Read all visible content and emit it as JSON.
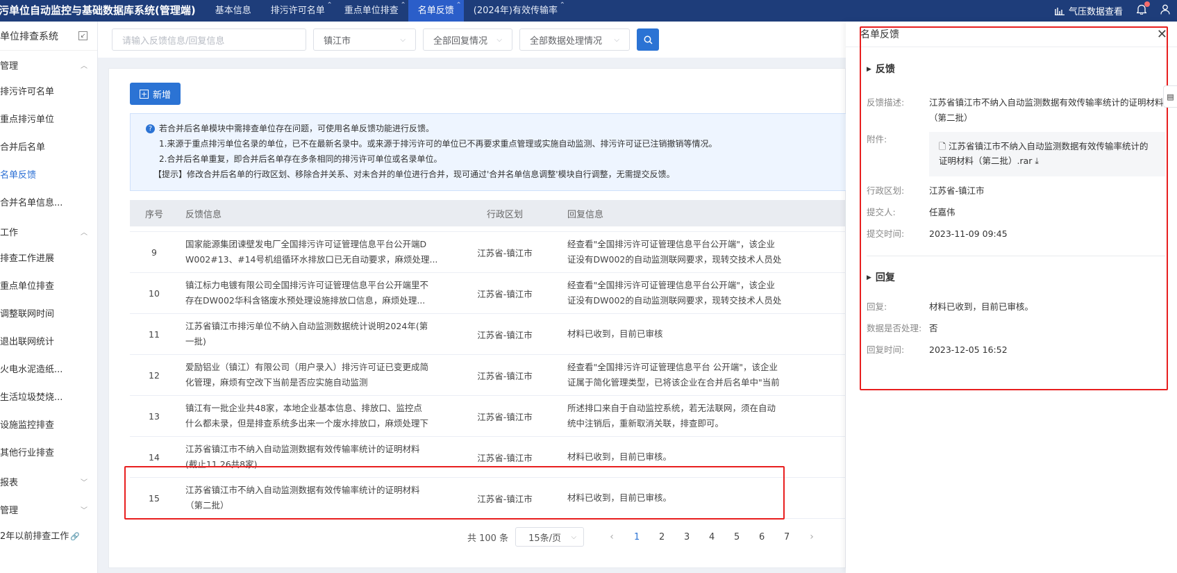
{
  "topbar": {
    "title": "污单位自动监控与基础数据库系统(管理端)",
    "tabs": [
      {
        "label": "基本信息",
        "closable": false,
        "active": false
      },
      {
        "label": "排污许可名单",
        "closable": true,
        "active": false
      },
      {
        "label": "重点单位排查",
        "closable": true,
        "active": false
      },
      {
        "label": "名单反馈",
        "closable": true,
        "active": true
      },
      {
        "label": "(2024年)有效传输率",
        "closable": true,
        "active": false
      }
    ],
    "pressure_label": "气压数据查看"
  },
  "sidebar": {
    "header": "单位排查系统",
    "items": [
      {
        "type": "group",
        "label": "管理",
        "expanded": true
      },
      {
        "type": "item",
        "label": "排污许可名单"
      },
      {
        "type": "item",
        "label": "重点排污单位"
      },
      {
        "type": "item",
        "label": "合并后名单"
      },
      {
        "type": "item",
        "label": "名单反馈",
        "active": true
      },
      {
        "type": "item",
        "label": "合并名单信息..."
      },
      {
        "type": "group",
        "label": "工作",
        "expanded": true
      },
      {
        "type": "item",
        "label": "排查工作进展"
      },
      {
        "type": "item",
        "label": "重点单位排查"
      },
      {
        "type": "item",
        "label": "调整联网时间"
      },
      {
        "type": "item",
        "label": "退出联网统计"
      },
      {
        "type": "item",
        "label": "火电水泥造纸..."
      },
      {
        "type": "item",
        "label": "生活垃圾焚烧..."
      },
      {
        "type": "item",
        "label": "设施监控排查"
      },
      {
        "type": "item",
        "label": "其他行业排查"
      },
      {
        "type": "group",
        "label": "报表",
        "expanded": false
      },
      {
        "type": "group",
        "label": "管理",
        "expanded": false
      },
      {
        "type": "item",
        "label": "2年以前排查工作",
        "external": true
      }
    ]
  },
  "filters": {
    "search_placeholder": "请输入反馈信息/回复信息",
    "city": "镇江市",
    "reply_status": "全部回复情况",
    "data_status": "全部数据处理情况"
  },
  "main": {
    "add_label": "新增",
    "notice": [
      "若合并后名单模块中需排查单位存在问题，可使用名单反馈功能进行反馈。",
      "1.来源于重点排污单位名录的单位，已不在最新名录中。或来源于排污许可的单位已不再要求重点管理或实施自动监测、排污许可证已注销撤销等情况。",
      "2.合并后名单重复，即合并后名单存在多条相同的排污许可单位或名录单位。",
      "【提示】修改合并后名单的行政区划、移除合并关系、对未合并的单位进行合并，现可通过'合并名单信息调整'模块自行调整，无需提交反馈。"
    ],
    "columns": {
      "no": "序号",
      "feedback": "反馈信息",
      "area": "行政区划",
      "reply": "回复信息"
    },
    "rows": [
      {
        "no": "9",
        "fb1": "国家能源集团谏壁发电厂全国排污许可证管理信息平台公开端D",
        "fb2": "W002#13、#14号机组循环水排放口已无自动要求，麻烦处理...",
        "area": "江苏省-镇江市",
        "r1": "经查看\"全国排污许可证管理信息平台公开端\"，该企业",
        "r2": "证没有DW002的自动监测联网要求，现转交技术人员处"
      },
      {
        "no": "10",
        "fb1": "镇江标力电镀有限公司全国排污许可证管理信息平台公开端里不",
        "fb2": "存在DW002华科含铬废水预处理设施排放口信息，麻烦处理...",
        "area": "江苏省-镇江市",
        "r1": "经查看\"全国排污许可证管理信息平台公开端\"，该企业",
        "r2": "证没有DW002的自动监测联网要求，现转交技术人员处"
      },
      {
        "no": "11",
        "fb1": "江苏省镇江市排污单位不纳入自动监测数据统计说明2024年(第",
        "fb2": "一批)",
        "area": "江苏省-镇江市",
        "r1": "材料已收到，目前已审核",
        "r2": ""
      },
      {
        "no": "12",
        "fb1": "爱励铝业（镇江）有限公司（用户录入）排污许可证已变更成简",
        "fb2": "化管理，麻烦有空改下当前是否应实施自动监测",
        "area": "江苏省-镇江市",
        "r1": "经查看\"全国排污许可证管理信息平台 公开端\"，该企业",
        "r2": "证属于简化管理类型，已将该企业在合并后名单中\"当前"
      },
      {
        "no": "13",
        "fb1": "镇江有一批企业共48家，本地企业基本信息、排放口、监控点",
        "fb2": "什么都未录，但是排查系统多出来一个废水排放口，麻烦处理下",
        "area": "江苏省-镇江市",
        "r1": "所述排口来自于自动监控系统，若无法联网，须在自动",
        "r2": "统中注销后，重新取消关联，排查即可。"
      },
      {
        "no": "14",
        "fb1": "江苏省镇江市不纳入自动监测数据有效传输率统计的证明材料",
        "fb2": "(截止11.26共8家)",
        "area": "江苏省-镇江市",
        "r1": "材料已收到，目前已审核。",
        "r2": ""
      },
      {
        "no": "15",
        "fb1": "江苏省镇江市不纳入自动监测数据有效传输率统计的证明材料",
        "fb2": "（第二批）",
        "area": "江苏省-镇江市",
        "r1": "材料已收到，目前已审核。",
        "r2": ""
      }
    ],
    "pager": {
      "total": "共 100 条",
      "size": "15条/页",
      "pages": [
        "1",
        "2",
        "3",
        "4",
        "5",
        "6",
        "7"
      ],
      "current": "1"
    }
  },
  "drawer": {
    "title": "名单反馈",
    "feedback_title": "反馈",
    "desc_label": "反馈描述:",
    "desc_value": "江苏省镇江市不纳入自动监测数据有效传输率统计的证明材料（第二批）",
    "attach_label": "附件:",
    "attach_value": "江苏省镇江市不纳入自动监测数据有效传输率统计的证明材料（第二批）.rar",
    "area_label": "行政区划:",
    "area_value": "江苏省-镇江市",
    "submitter_label": "提交人:",
    "submitter_value": "任嘉伟",
    "submit_time_label": "提交时间:",
    "submit_time_value": "2023-11-09 09:45",
    "reply_title": "回复",
    "reply_label": "回复:",
    "reply_value": "材料已收到，目前已审核。",
    "processed_label": "数据是否处理:",
    "processed_value": "否",
    "reply_time_label": "回复时间:",
    "reply_time_value": "2023-12-05 16:52"
  },
  "colors": {
    "topbar": "#1e3d7a",
    "active_tab": "#2b5ec9",
    "primary": "#2b73d4",
    "highlight": "#e81e1e"
  }
}
